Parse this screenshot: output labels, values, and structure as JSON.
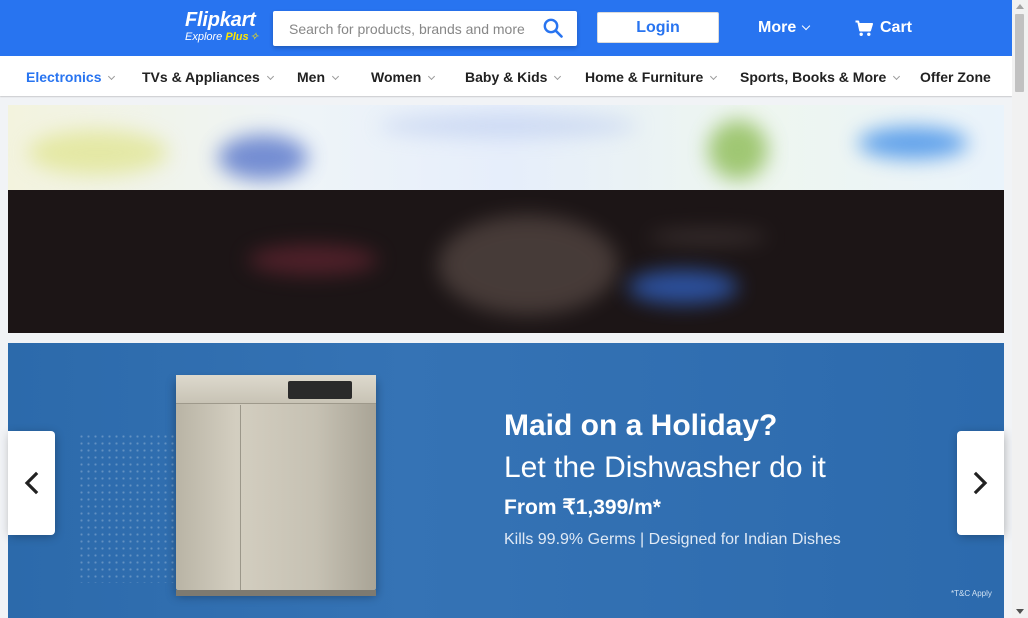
{
  "header": {
    "logo": {
      "name": "Flipkart",
      "tagline": "Explore",
      "plus": "Plus"
    },
    "search": {
      "placeholder": "Search for products, brands and more",
      "value": ""
    },
    "login_label": "Login",
    "more_label": "More",
    "cart_label": "Cart"
  },
  "nav": {
    "items": [
      {
        "label": "Electronics",
        "active": true
      },
      {
        "label": "TVs & Appliances"
      },
      {
        "label": "Men"
      },
      {
        "label": "Women"
      },
      {
        "label": "Baby & Kids"
      },
      {
        "label": "Home & Furniture"
      },
      {
        "label": "Sports, Books & More"
      },
      {
        "label": "Offer Zone"
      }
    ]
  },
  "hero": {
    "title": "Maid on a Holiday?",
    "subtitle": "Let the Dishwasher do it",
    "price": "From ₹1,399/m*",
    "tagline": "Kills 99.9% Germs | Designed for Indian Dishes",
    "note": "*T&C Apply"
  },
  "colors": {
    "brand_blue": "#2874f0",
    "plus_yellow": "#ffe500",
    "hero_blue": "#3573b5"
  }
}
